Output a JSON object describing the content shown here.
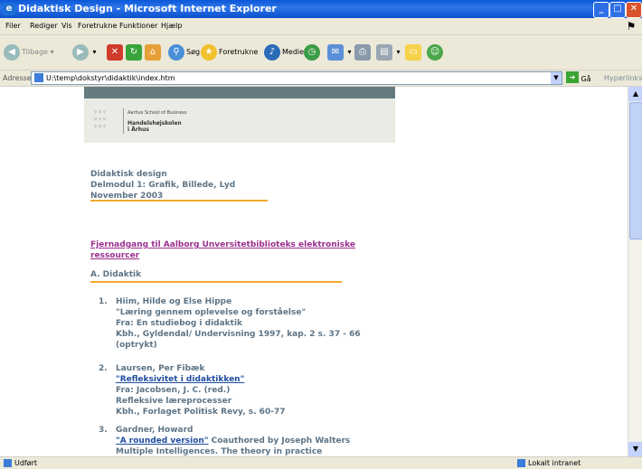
{
  "window": {
    "title": "Didaktisk Design - Microsoft Internet Explorer"
  },
  "menu": [
    "Filer",
    "Rediger",
    "Vis",
    "Foretrukne",
    "Funktioner",
    "Hjælp"
  ],
  "toolbar": {
    "back": "Tilbage",
    "search": "Søg",
    "favorites": "Foretrukne",
    "media": "Medier"
  },
  "address": {
    "label": "Adresse",
    "url": "U:\\temp\\dokstyr\\didaktik\\index.htm",
    "go": "Gå",
    "links": "Hyperlinks"
  },
  "header": {
    "school_en": "Aarhus School of Business",
    "school_da_1": "Handelshøjskolen",
    "school_da_2": "i Århus"
  },
  "course": {
    "title": "Didaktisk design",
    "module": "Delmodul 1: Grafik, Billede, Lyd",
    "date": "November 2003"
  },
  "remote_link": {
    "line1": "Fjernadgang til Aalborg Unversitetbiblioteks elektroniske",
    "line2": "ressourcer"
  },
  "section_a": "A. Didaktik",
  "references": [
    {
      "num": "1.",
      "lines": [
        "Hiim, Hilde og Else Hippe",
        "\"Læring gennem oplevelse og forståelse\"",
        "Fra: En studiebog i didaktik",
        "Kbh., Gyldendal/ Undervisning 1997, kap. 2 s. 37 - 66",
        "(optrykt)"
      ]
    },
    {
      "num": "2.",
      "author": "Laursen, Per Fibæk",
      "link": "\"Refleksivitet i didaktikken\"",
      "lines": [
        "Fra: Jacobsen, J. C. (red.)",
        "Refleksive læreprocesser",
        "Kbh., Forlaget Politisk Revy, s. 60-77"
      ]
    },
    {
      "num": "3.",
      "author": "Gardner, Howard",
      "link": "\"A rounded version\"",
      "link_suffix": " Coauthored by Joseph Walters",
      "lines": [
        "Multiple Intelligences. The theory in practice"
      ]
    }
  ],
  "status": {
    "left": "Udført",
    "right": "Lokalt intranet"
  }
}
